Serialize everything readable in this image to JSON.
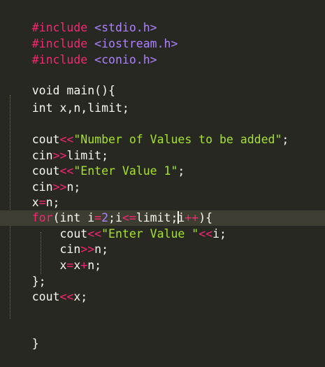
{
  "colors": {
    "background": "#272822",
    "active_line": "#3e3d32",
    "text": "#f8f8f2",
    "preprocessor": "#f92672",
    "header_name": "#ae81ff",
    "operator": "#f92672",
    "number": "#ae81ff",
    "string": "#a6e22e"
  },
  "code": {
    "l1": {
      "kw": "#include",
      "hdr": "<stdio.h>"
    },
    "l2": {
      "kw": "#include",
      "hdr": "<iostream.h>"
    },
    "l3": {
      "kw": "#include",
      "hdr": "<conio.h>"
    },
    "l5": {
      "text": "void main(){"
    },
    "l7": {
      "text": "int x,n,limit;"
    },
    "l9": {
      "a": "cout",
      "op": "<<",
      "str": "\"Number of Values to be added\"",
      "end": ";"
    },
    "l10": {
      "a": "cin",
      "op": ">>",
      "b": "limit;"
    },
    "l11": {
      "a": "cout",
      "op": "<<",
      "str": "\"Enter Value 1\"",
      "end": ";"
    },
    "l12": {
      "a": "cin",
      "op": ">>",
      "b": "n;"
    },
    "l13": {
      "a": "x",
      "op": "=",
      "b": "n;"
    },
    "l14": {
      "for": "for",
      "p1": "(int i",
      "eq": "=",
      "two": "2",
      "p2": ";i",
      "le": "<=",
      "p3": "limit;",
      "p4": "i",
      "pp": "++",
      "p5": "){"
    },
    "l15": {
      "a": "cout",
      "op": "<<",
      "str": "\"Enter Value \"",
      "op2": "<<",
      "b": "i;"
    },
    "l16": {
      "a": "cin",
      "op": ">>",
      "b": "n;"
    },
    "l17": {
      "a": "x",
      "op": "=",
      "b": "x",
      "op2": "+",
      "c": "n;"
    },
    "l18": {
      "text": "};"
    },
    "l19": {
      "a": "cout",
      "op": "<<",
      "b": "x;"
    },
    "l21": {
      "text": "}"
    }
  }
}
